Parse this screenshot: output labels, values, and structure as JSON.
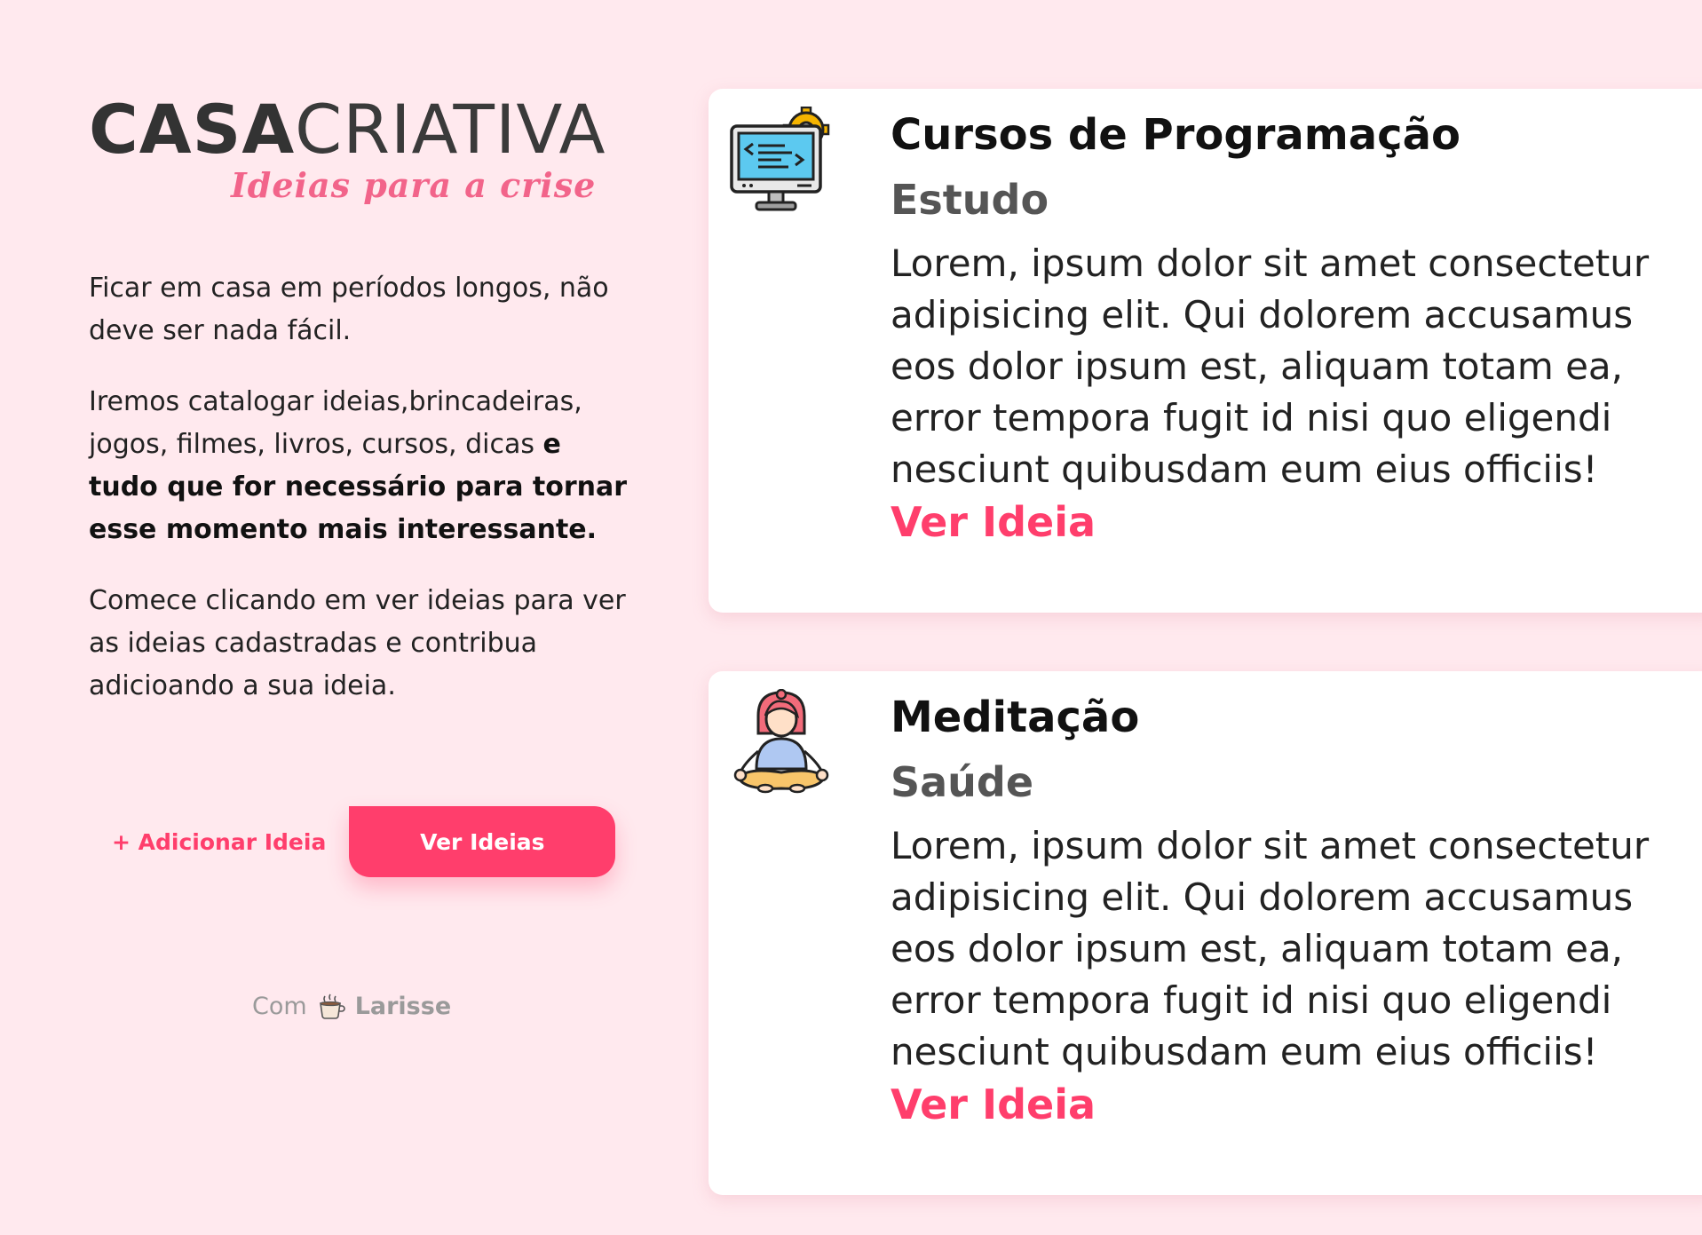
{
  "brand": {
    "logo_casa": "CASA",
    "logo_criativa": "CRIATIVA",
    "tagline": "Ideias para a crise"
  },
  "intro": {
    "p1": "Ficar em casa em períodos longos, não deve ser nada fácil.",
    "p2_regular": "Iremos catalogar ideias,brincadeiras, jogos, filmes, livros, cursos, dicas ",
    "p2_bold": "e tudo que for necessário para tornar esse momento mais interessante.",
    "p3": "Comece clicando em ver ideias para ver as ideias cadastradas e contribua adicioando a sua ideia."
  },
  "actions": {
    "add_label": "+ Adicionar Ideia",
    "see_label": "Ver Ideias"
  },
  "credit": {
    "prefix": "Com",
    "icon": "coffee-cup-icon",
    "name": "Larisse"
  },
  "colors": {
    "background": "#FFE9EE",
    "accent": "#FF3E6C",
    "logo_tagline": "#F2648A"
  },
  "ideas": [
    {
      "icon": "computer-code-icon",
      "title": "Cursos de Programação",
      "category": "Estudo",
      "description": "Lorem, ipsum dolor sit amet consectetur adipisicing elit. Qui dolorem accusamus eos dolor ipsum est, aliquam totam ea, error tempora fugit id nisi quo eligendi nesciunt quibusdam eum eius officiis!",
      "link_label": "Ver Ideia"
    },
    {
      "icon": "meditation-icon",
      "title": "Meditação",
      "category": "Saúde",
      "description": "Lorem, ipsum dolor sit amet consectetur adipisicing elit. Qui dolorem accusamus eos dolor ipsum est, aliquam totam ea, error tempora fugit id nisi quo eligendi nesciunt quibusdam eum eius officiis!",
      "link_label": "Ver Ideia"
    }
  ]
}
